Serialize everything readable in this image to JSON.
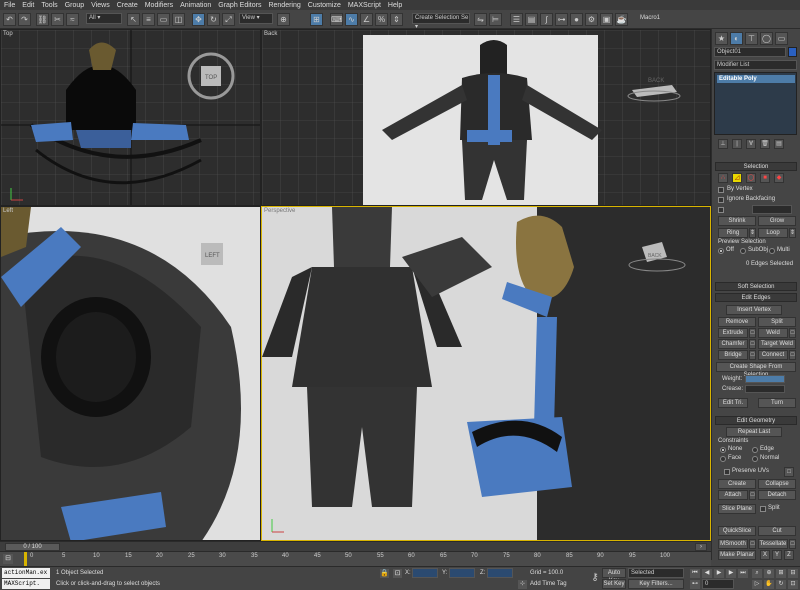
{
  "menu": [
    "File",
    "Edit",
    "Tools",
    "Group",
    "Views",
    "Create",
    "Modifiers",
    "Animation",
    "Graph Editors",
    "Rendering",
    "Customize",
    "MAXScript",
    "Help"
  ],
  "toolbar": {
    "filter": "All",
    "view": "View",
    "selection_set": "Create Selection Se",
    "macro": "Macro1"
  },
  "viewports": {
    "top": "Top",
    "back": "Back",
    "left": "Left",
    "perspective": "Perspective",
    "viewcube_top": "TOP",
    "viewcube_back": "BACK",
    "viewcube_left": "LEFT",
    "viewcube_persp": "BACK"
  },
  "panel": {
    "object_name": "Object01",
    "modifier_list": "Modifier List",
    "stack_item": "Editable Poly",
    "selection": {
      "title": "Selection",
      "by_vertex": "By Vertex",
      "ignore_backfacing": "Ignore Backfacing",
      "shrink": "Shrink",
      "grow": "Grow",
      "ring": "Ring",
      "loop": "Loop",
      "preview": "Preview Selection",
      "off": "Off",
      "subobj": "SubObj",
      "multi": "Multi",
      "status": "0 Edges Selected"
    },
    "soft_selection": "Soft Selection",
    "edit_edges": {
      "title": "Edit Edges",
      "insert_vertex": "Insert Vertex",
      "remove": "Remove",
      "split": "Split",
      "extrude": "Extrude",
      "weld": "Weld",
      "chamfer": "Chamfer",
      "target_weld": "Target Weld",
      "bridge": "Bridge",
      "connect": "Connect",
      "create_shape": "Create Shape From Selection",
      "weight": "Weight:",
      "crease": "Crease:",
      "edit_tri": "Edit Tri.",
      "turn": "Turn"
    },
    "edit_geometry": {
      "title": "Edit Geometry",
      "repeat_last": "Repeat Last",
      "constraints": "Constraints",
      "none": "None",
      "edge": "Edge",
      "face": "Face",
      "normal": "Normal",
      "preserve_uvs": "Preserve UVs",
      "create": "Create",
      "collapse": "Collapse",
      "attach": "Attach",
      "detach": "Detach",
      "slice_plane": "Slice Plane",
      "split": "Split",
      "quickslice": "QuickSlice",
      "cut": "Cut",
      "msmooth": "MSmooth",
      "tessellate": "Tessellate",
      "make_planar": "Make Planar",
      "x": "X",
      "y": "Y",
      "z": "Z"
    }
  },
  "timeline": {
    "frame": "0 / 100",
    "ticks": [
      "0",
      "5",
      "10",
      "15",
      "20",
      "25",
      "30",
      "35",
      "40",
      "45",
      "50",
      "55",
      "60",
      "65",
      "70",
      "75",
      "80",
      "85",
      "90",
      "95",
      "100"
    ]
  },
  "status": {
    "listener_top": "actionMan.ex",
    "listener_bottom": "MAXScript.",
    "selected": "1 Object Selected",
    "prompt": "Click or click-and-drag to select objects",
    "x_label": "X:",
    "y_label": "Y:",
    "z_label": "Z:",
    "grid": "Grid = 100.0",
    "add_time_tag": "Add Time Tag",
    "auto_key": "Auto Key",
    "set_key": "Set Key",
    "key_selected": "Selected",
    "key_filters": "Key Filters...",
    "current_frame": "0"
  },
  "colors": {
    "selection_blue": "#4d7ca8",
    "viewport_dark": "#2c2c2c",
    "viewport_light": "#e6e6e6"
  }
}
